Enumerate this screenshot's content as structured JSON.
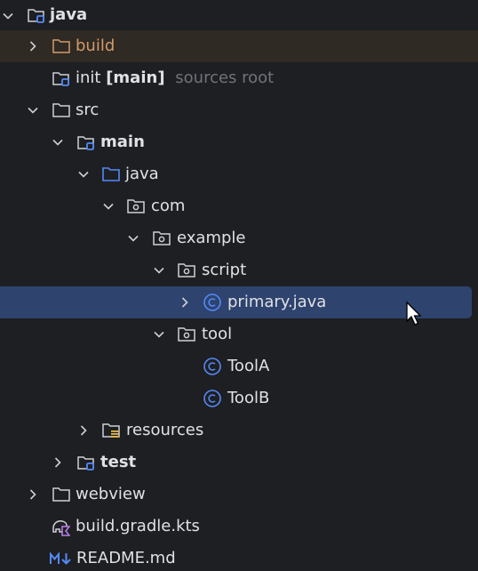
{
  "tree": [
    {
      "key": "java_root",
      "label": "java",
      "bold": true,
      "arrow": "down",
      "icon": "module-folder-icon"
    },
    {
      "key": "build",
      "label": "build",
      "arrow": "right",
      "icon": "excluded-folder-icon"
    },
    {
      "key": "init",
      "label": "init",
      "label_bold": "[main]",
      "hint": "sources root",
      "arrow": "none",
      "icon": "module-folder-icon"
    },
    {
      "key": "src",
      "label": "src",
      "arrow": "down",
      "icon": "folder-icon"
    },
    {
      "key": "main",
      "label": "main",
      "bold": true,
      "arrow": "down",
      "icon": "module-folder-icon"
    },
    {
      "key": "java_src",
      "label": "java",
      "arrow": "down",
      "icon": "source-folder-icon"
    },
    {
      "key": "com",
      "label": "com",
      "arrow": "down",
      "icon": "package-icon"
    },
    {
      "key": "example",
      "label": "example",
      "arrow": "down",
      "icon": "package-icon"
    },
    {
      "key": "script",
      "label": "script",
      "arrow": "down",
      "icon": "package-icon"
    },
    {
      "key": "primary",
      "label": "primary.java",
      "arrow": "right",
      "icon": "java-class-icon",
      "selected": true
    },
    {
      "key": "tool",
      "label": "tool",
      "arrow": "down",
      "icon": "package-icon"
    },
    {
      "key": "toola",
      "label": "ToolA",
      "arrow": "none",
      "icon": "java-class-icon"
    },
    {
      "key": "toolb",
      "label": "ToolB",
      "arrow": "none",
      "icon": "java-class-icon"
    },
    {
      "key": "resources",
      "label": "resources",
      "arrow": "right",
      "icon": "resources-folder-icon"
    },
    {
      "key": "test",
      "label": "test",
      "bold": true,
      "arrow": "right",
      "icon": "module-folder-icon"
    },
    {
      "key": "webview",
      "label": "webview",
      "arrow": "right",
      "icon": "folder-icon"
    },
    {
      "key": "gradle",
      "label": "build.gradle.kts",
      "arrow": "none",
      "icon": "gradle-kts-icon"
    },
    {
      "key": "readme",
      "label": "README.md",
      "arrow": "none",
      "icon": "markdown-icon"
    }
  ],
  "colors": {
    "background": "#1e1f22",
    "selection": "#2e436e",
    "excluded_row": "#2f2a23",
    "excluded_text": "#d29a6c",
    "accent_blue": "#548af7",
    "hint": "#6f737a"
  }
}
